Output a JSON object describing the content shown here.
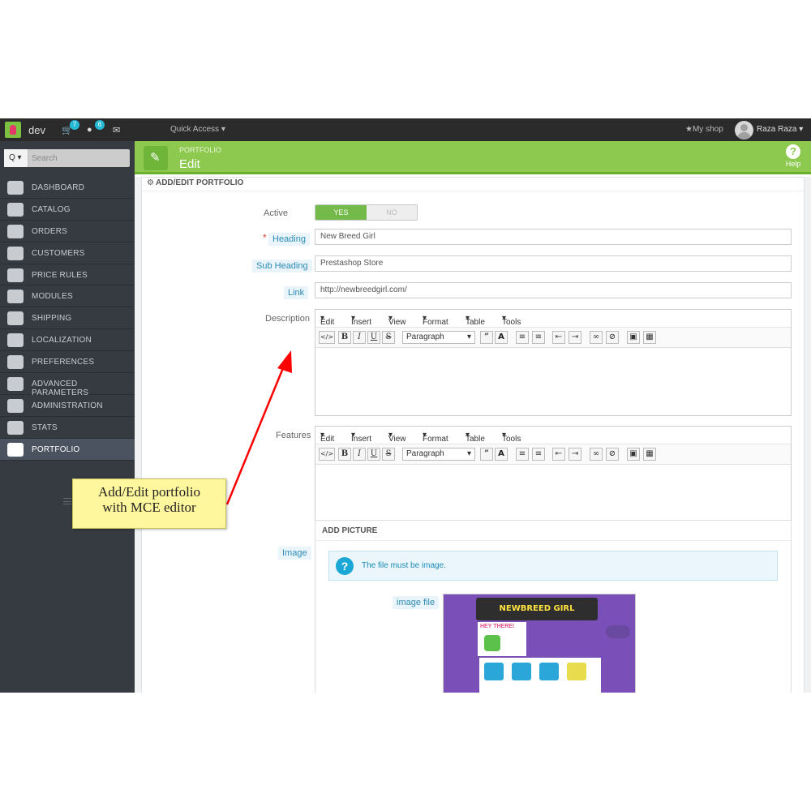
{
  "topbar": {
    "shop_name": "dev",
    "cart_badge": "7",
    "customers_badge": "6",
    "quick_access": "Quick Access",
    "my_shop": "My shop",
    "user_name": "Raza Raza"
  },
  "sidebar": {
    "search_mode": "Q",
    "search_placeholder": "Search",
    "items": [
      {
        "label": "DASHBOARD",
        "icon": "dashboard-icon"
      },
      {
        "label": "CATALOG",
        "icon": "catalog-icon"
      },
      {
        "label": "ORDERS",
        "icon": "orders-icon"
      },
      {
        "label": "CUSTOMERS",
        "icon": "customers-icon"
      },
      {
        "label": "PRICE RULES",
        "icon": "price-rules-icon"
      },
      {
        "label": "MODULES",
        "icon": "modules-icon"
      },
      {
        "label": "SHIPPING",
        "icon": "shipping-icon"
      },
      {
        "label": "LOCALIZATION",
        "icon": "localization-icon"
      },
      {
        "label": "PREFERENCES",
        "icon": "preferences-icon"
      },
      {
        "label": "ADVANCED PARAMETERS",
        "icon": "advanced-parameters-icon"
      },
      {
        "label": "ADMINISTRATION",
        "icon": "administration-icon"
      },
      {
        "label": "STATS",
        "icon": "stats-icon"
      },
      {
        "label": "PORTFOLIO",
        "icon": "portfolio-icon",
        "active": true
      }
    ]
  },
  "header": {
    "breadcrumb": "PORTFOLIO",
    "title": "Edit",
    "help_label": "Help"
  },
  "panel": {
    "heading": "ADD/EDIT PORTFOLIO"
  },
  "form": {
    "active_label": "Active",
    "active_yes": "YES",
    "active_no": "NO",
    "active_value": "YES",
    "heading_label": "Heading",
    "heading_value": "New Breed Girl",
    "subheading_label": "Sub Heading",
    "subheading_value": "Prestashop Store",
    "link_label": "Link",
    "link_value": "http://newbreedgirl.com/",
    "description_label": "Description",
    "features_label": "Features",
    "image_label": "Image"
  },
  "editor": {
    "menus": [
      "Edit",
      "Insert",
      "View",
      "Format",
      "Table",
      "Tools"
    ],
    "paragraph": "Paragraph",
    "buttons": [
      "</>",
      "B",
      "I",
      "U",
      "S"
    ]
  },
  "picture": {
    "heading": "ADD PICTURE",
    "info": "The file must be image.",
    "file_label": "image file",
    "thumb_banner": "NEWBREED GIRL",
    "thumb_text": "HEY THERE!"
  },
  "annotation": {
    "line1": "Add/Edit portfolio",
    "line2": "with MCE editor",
    "color": "#ff0000"
  },
  "colors": {
    "accent_green": "#8cc94e",
    "sidebar": "#363a41",
    "topbar": "#2b2b2b",
    "info_blue": "#1ba7d6"
  }
}
